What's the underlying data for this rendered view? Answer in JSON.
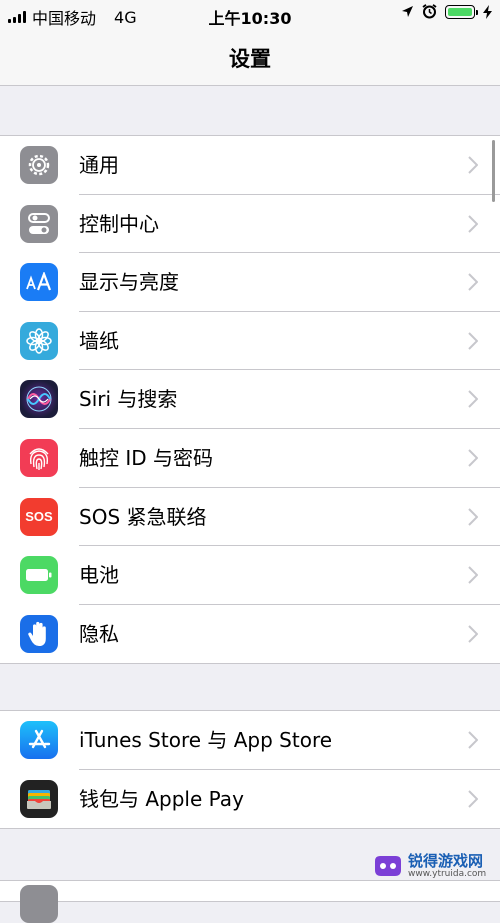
{
  "status_bar": {
    "carrier": "中国移动",
    "network": "4G",
    "time": "上午10:30"
  },
  "nav": {
    "title": "设置"
  },
  "groups": [
    {
      "items": [
        {
          "label": "通用",
          "icon": "gear-icon",
          "color": "#8e8e93"
        },
        {
          "label": "控制中心",
          "icon": "toggles-icon",
          "color": "#8e8e93"
        },
        {
          "label": "显示与亮度",
          "icon": "display-aa-icon",
          "color": "#1a7cf5"
        },
        {
          "label": "墙纸",
          "icon": "flower-icon",
          "color": "#35aadc"
        },
        {
          "label": "Siri 与搜索",
          "icon": "siri-icon",
          "color": "#1c1c3a"
        },
        {
          "label": "触控 ID 与密码",
          "icon": "fingerprint-icon",
          "color": "#f23c55"
        },
        {
          "label": "SOS 紧急联络",
          "icon": "sos-icon",
          "color": "#f23c2f",
          "icon_text": "SOS"
        },
        {
          "label": "电池",
          "icon": "battery-icon",
          "color": "#4cd964"
        },
        {
          "label": "隐私",
          "icon": "hand-icon",
          "color": "#1a6ee8"
        }
      ]
    },
    {
      "items": [
        {
          "label": "iTunes Store 与 App Store",
          "icon": "app-store-icon",
          "color": "#1a8af5"
        },
        {
          "label": "钱包与 Apple Pay",
          "icon": "wallet-icon",
          "color": "#222222"
        }
      ]
    }
  ],
  "watermark": {
    "name": "锐得游戏网",
    "url": "www.ytruida.com"
  }
}
